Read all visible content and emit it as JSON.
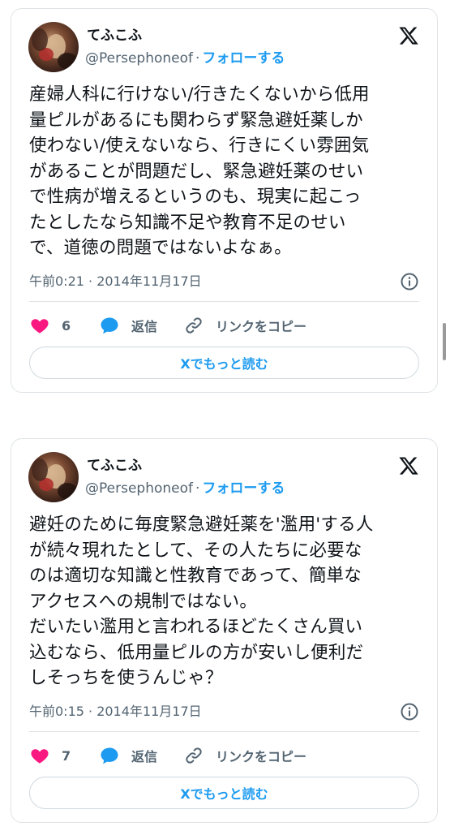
{
  "tweets": [
    {
      "author_name": "てふこふ",
      "handle": "@Persephoneof",
      "separator": "·",
      "follow_label": "フォローする",
      "text": "産婦人科に行けない/行きたくないから低用\n量ピルがあるにも関わらず緊急避妊薬しか\n使わない/使えないなら、行きにくい雰囲気\nがあることが問題だし、緊急避妊薬のせい\nで性病が増えるというのも、現実に起こっ\nたとしたなら知識不足や教育不足のせい\nで、道徳の問題ではないよなぁ。",
      "timestamp": "午前0:21 · 2014年11月17日",
      "like_count": "6",
      "reply_label": "返信",
      "copy_link_label": "リンクをコピー",
      "read_more_label": "Xでもっと読む"
    },
    {
      "author_name": "てふこふ",
      "handle": "@Persephoneof",
      "separator": "·",
      "follow_label": "フォローする",
      "text": "避妊のために毎度緊急避妊薬を'濫用'する人\nが続々現れたとして、その人たちに必要な\nのは適切な知識と性教育であって、簡単な\nアクセスへの規制ではない。\nだいたい濫用と言われるほどたくさん買い\n込むなら、低用量ピルの方が安いし便利だ\nしそっちを使うんじゃ？",
      "timestamp": "午前0:15 · 2014年11月17日",
      "like_count": "7",
      "reply_label": "返信",
      "copy_link_label": "リンクをコピー",
      "read_more_label": "Xでもっと読む"
    }
  ],
  "colors": {
    "accent": "#1d9bf0",
    "like_heart": "#f91880",
    "secondary_text": "#536471",
    "border": "#dfe3e6"
  },
  "icons": {
    "platform_logo": "x-logo-icon",
    "info": "info-icon",
    "like": "heart-icon",
    "reply": "speech-bubble-icon",
    "copy_link": "link-icon"
  }
}
